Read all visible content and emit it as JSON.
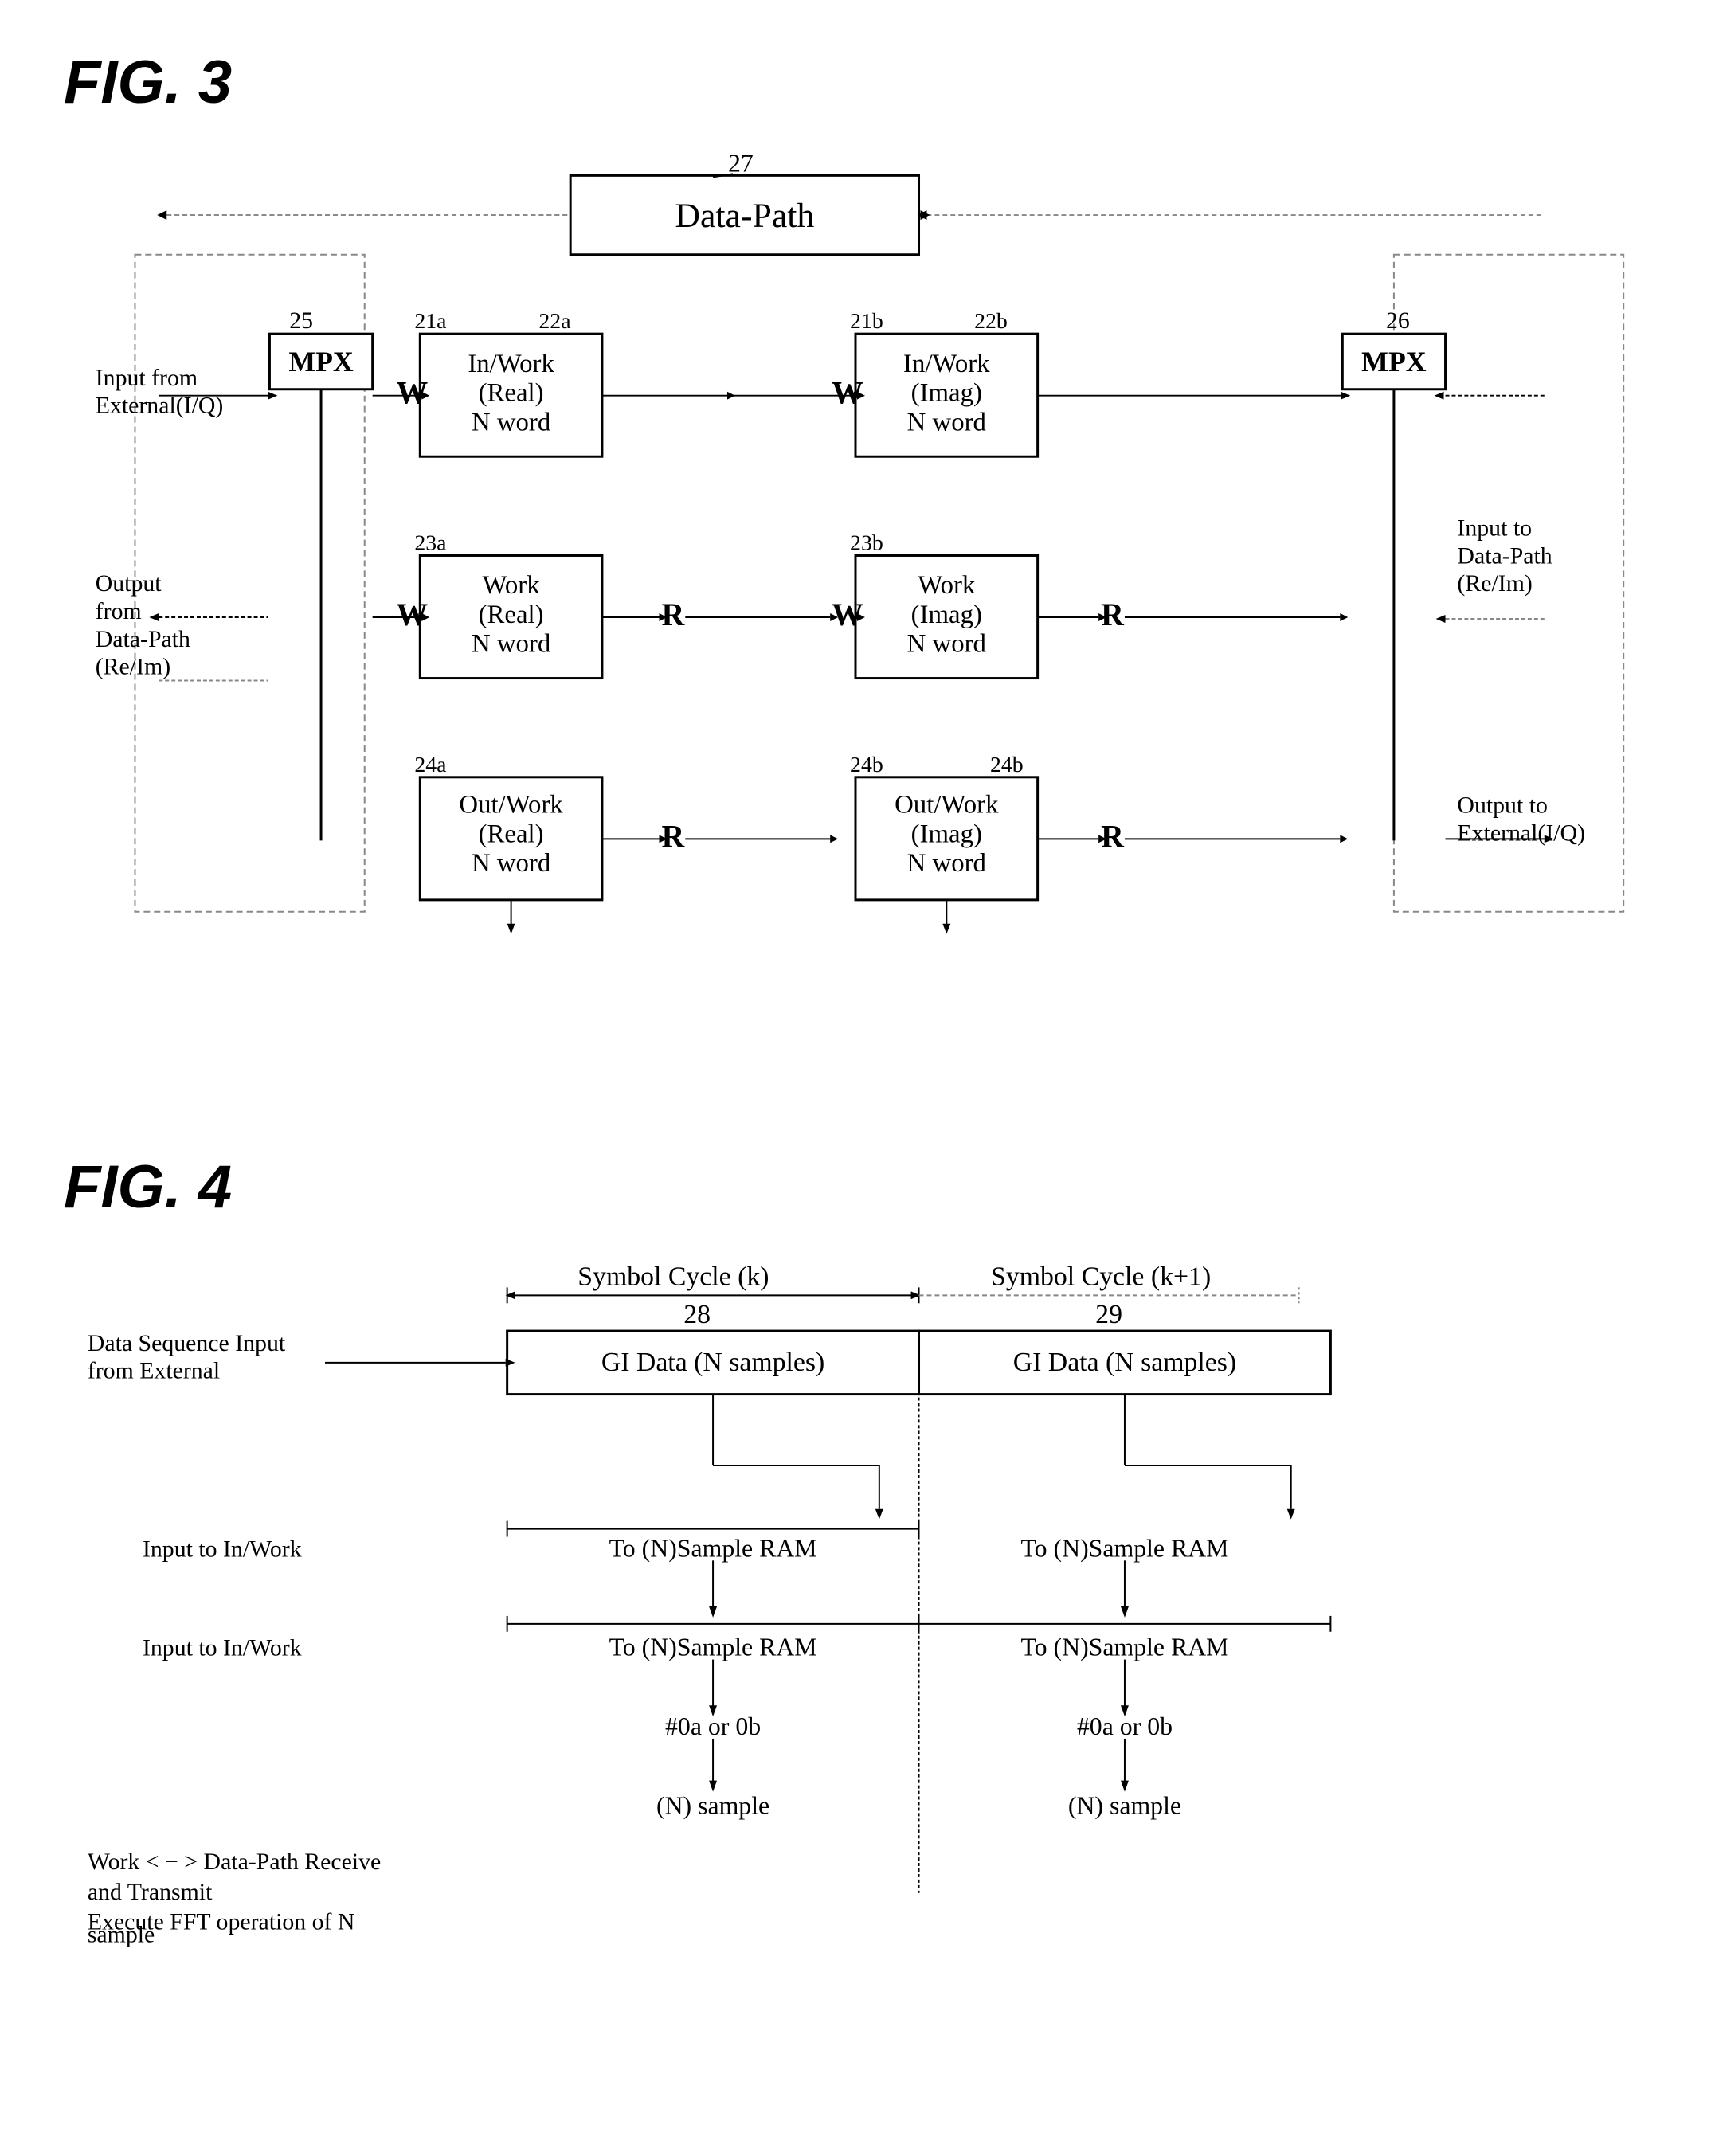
{
  "fig3": {
    "title": "FIG. 3",
    "label27": "27",
    "datapath_label": "Data-Path",
    "label25": "25",
    "label26": "26",
    "mpx_left": "MPX",
    "mpx_right": "MPX",
    "label21a": "21a",
    "label22a": "22a",
    "label21b": "21b",
    "label22b": "22b",
    "label23a": "23a",
    "label23b": "23b",
    "label24a": "24a",
    "label24b": "24b",
    "box22a": [
      "In/Work",
      "(Real)",
      "N word"
    ],
    "box22b": [
      "In/Work",
      "(Imag)",
      "N word"
    ],
    "box23a": [
      "Work",
      "(Real)",
      "N word"
    ],
    "box23b": [
      "Work",
      "(Imag)",
      "N word"
    ],
    "box24a": [
      "Out/Work",
      "(Real)",
      "N word"
    ],
    "box24b": [
      "Out/Work",
      "(Imag)",
      "N word"
    ],
    "input_ext": [
      "Input from",
      "External(I/Q)"
    ],
    "output_from": [
      "Output",
      "from",
      "Data-Path",
      "(Re/Im)"
    ],
    "input_to": [
      "Input to",
      "Data-Path",
      "(Re/Im)"
    ],
    "output_to": [
      "Output to",
      "External(I/Q)"
    ],
    "w_labels": [
      "W",
      "W",
      "W",
      "W"
    ],
    "r_labels": [
      "R",
      "R",
      "R"
    ]
  },
  "fig4": {
    "title": "FIG. 4",
    "symbol_cycle_k": "Symbol Cycle (k)",
    "symbol_cycle_k1": "Symbol Cycle (k+1)",
    "label28": "28",
    "label29": "29",
    "data_seq": [
      "Data Sequence Input",
      "from External"
    ],
    "input_inwork1": "Input to In/Work",
    "input_inwork2": "Input to In/Work",
    "gi_data1": "GI  Data (N samples)",
    "gi_data2": "GI  Data (N samples)",
    "to_nsample1": "To (N)Sample RAM",
    "to_nsample2": "To (N)Sample RAM",
    "to_nsample3": "To (N)Sample RAM",
    "to_nsample4": "To (N)Sample RAM",
    "hash0a_0b_1": "#0a or 0b",
    "hash0a_0b_2": "#0a or 0b",
    "n_sample1": "(N) sample",
    "n_sample2": "(N) sample",
    "work_text": "Work < − > Data-Path Receive",
    "and_transmit": "and Transmit",
    "execute_fft": "Execute  FFT  operation  of  N",
    "sample": "sample",
    "of_label": "of"
  }
}
